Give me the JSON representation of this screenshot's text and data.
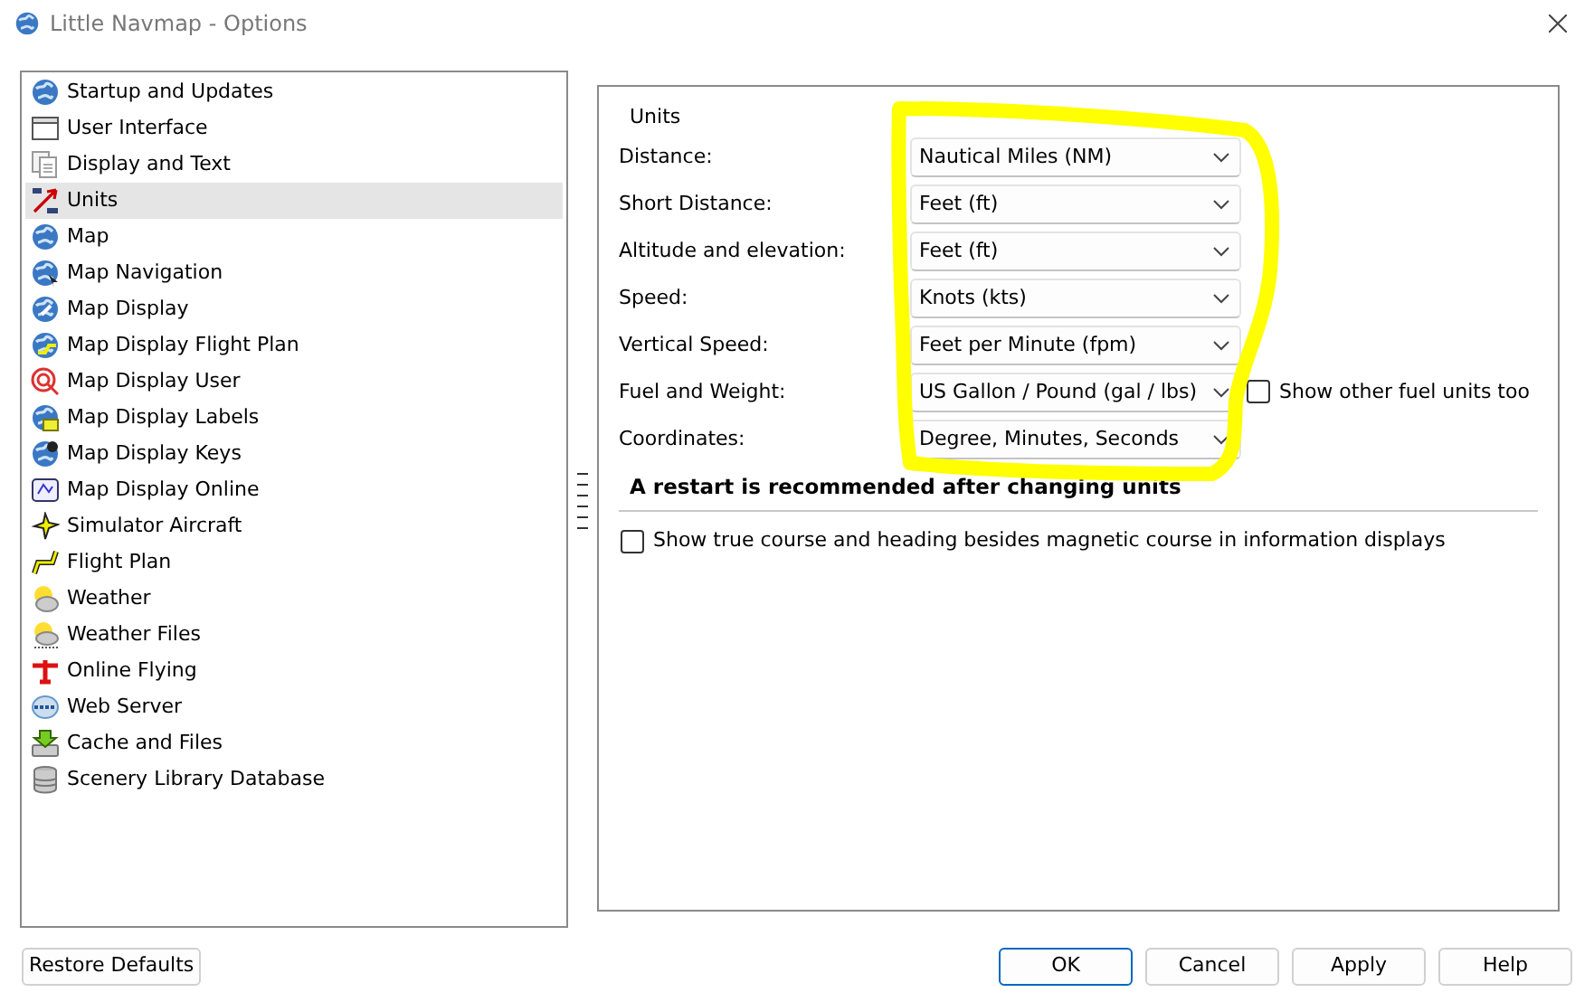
{
  "window": {
    "title": "Little Navmap - Options"
  },
  "sidebar": {
    "items": [
      {
        "label": "Startup and Updates",
        "selected": false
      },
      {
        "label": "User Interface",
        "selected": false
      },
      {
        "label": "Display and Text",
        "selected": false
      },
      {
        "label": "Units",
        "selected": true
      },
      {
        "label": "Map",
        "selected": false
      },
      {
        "label": "Map Navigation",
        "selected": false
      },
      {
        "label": "Map Display",
        "selected": false
      },
      {
        "label": "Map Display Flight Plan",
        "selected": false
      },
      {
        "label": "Map Display User",
        "selected": false
      },
      {
        "label": "Map Display Labels",
        "selected": false
      },
      {
        "label": "Map Display Keys",
        "selected": false
      },
      {
        "label": "Map Display Online",
        "selected": false
      },
      {
        "label": "Simulator Aircraft",
        "selected": false
      },
      {
        "label": "Flight Plan",
        "selected": false
      },
      {
        "label": "Weather",
        "selected": false
      },
      {
        "label": "Weather Files",
        "selected": false
      },
      {
        "label": "Online Flying",
        "selected": false
      },
      {
        "label": "Web Server",
        "selected": false
      },
      {
        "label": "Cache and Files",
        "selected": false
      },
      {
        "label": "Scenery Library Database",
        "selected": false
      }
    ]
  },
  "units": {
    "title": "Units",
    "fields": [
      {
        "label": "Distance:",
        "value": "Nautical Miles (NM)"
      },
      {
        "label": "Short Distance:",
        "value": "Feet (ft)"
      },
      {
        "label": "Altitude and elevation:",
        "value": "Feet (ft)"
      },
      {
        "label": "Speed:",
        "value": "Knots (kts)"
      },
      {
        "label": "Vertical Speed:",
        "value": "Feet per Minute (fpm)"
      },
      {
        "label": "Fuel and Weight:",
        "value": "US Gallon / Pound (gal / lbs)",
        "extra_checkbox": {
          "label": "Show other fuel units too",
          "checked": false
        }
      },
      {
        "label": "Coordinates:",
        "value": "Degree, Minutes, Seconds"
      }
    ],
    "notice": "A restart is recommended after changing units",
    "true_course_checkbox": {
      "label": "Show true course and heading besides magnetic course in information displays",
      "checked": false
    }
  },
  "annotation": {
    "kind": "freehand-highlight"
  },
  "buttons": {
    "restore": "Restore Defaults",
    "actions": [
      {
        "label": "OK",
        "default": true
      },
      {
        "label": "Cancel",
        "default": false
      },
      {
        "label": "Apply",
        "default": false
      },
      {
        "label": "Help",
        "default": false
      }
    ]
  }
}
